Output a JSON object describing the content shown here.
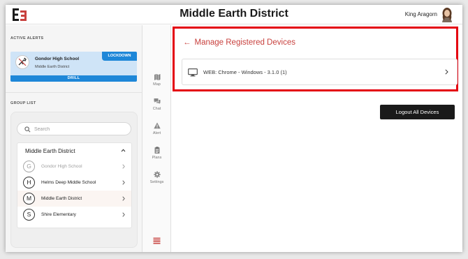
{
  "header": {
    "title": "Middle Earth District",
    "user_name": "King Aragorn",
    "brand_color": "#c8413e"
  },
  "alerts": {
    "section_label": "ACTIVE ALERTS",
    "items": [
      {
        "school": "Gondor High School",
        "district": "Middle Earth District",
        "badge": "LOCKDOWN",
        "mode": "DRILL",
        "icon": "no-weapon-icon",
        "color": "#1e87d8"
      }
    ]
  },
  "group_list": {
    "section_label": "GROUP LIST",
    "search_placeholder": "Search",
    "group_name": "Middle Earth District",
    "items": [
      {
        "letter": "G",
        "label": "Gondor High School",
        "state": "disabled"
      },
      {
        "letter": "H",
        "label": "Helms Deep Middle School",
        "state": "normal"
      },
      {
        "letter": "M",
        "label": "Middle Earth District",
        "state": "active"
      },
      {
        "letter": "S",
        "label": "Shire Elementary",
        "state": "normal"
      }
    ]
  },
  "nav": {
    "items": [
      {
        "label": "Map",
        "icon": "map-icon"
      },
      {
        "label": "Chat",
        "icon": "chat-icon"
      },
      {
        "label": "Alert",
        "icon": "alert-icon"
      },
      {
        "label": "Plans",
        "icon": "plans-icon"
      },
      {
        "label": "Settings",
        "icon": "settings-icon"
      }
    ],
    "menu_icon": "hamburger-menu-icon"
  },
  "main": {
    "back_arrow": "←",
    "page_title": "Manage Registered Devices",
    "devices": [
      {
        "label": "WEB: Chrome - Windows - 3.1.0 (1)",
        "icon": "monitor-icon"
      }
    ],
    "logout_button": "Logout All Devices",
    "highlight_color": "#e4000f"
  }
}
